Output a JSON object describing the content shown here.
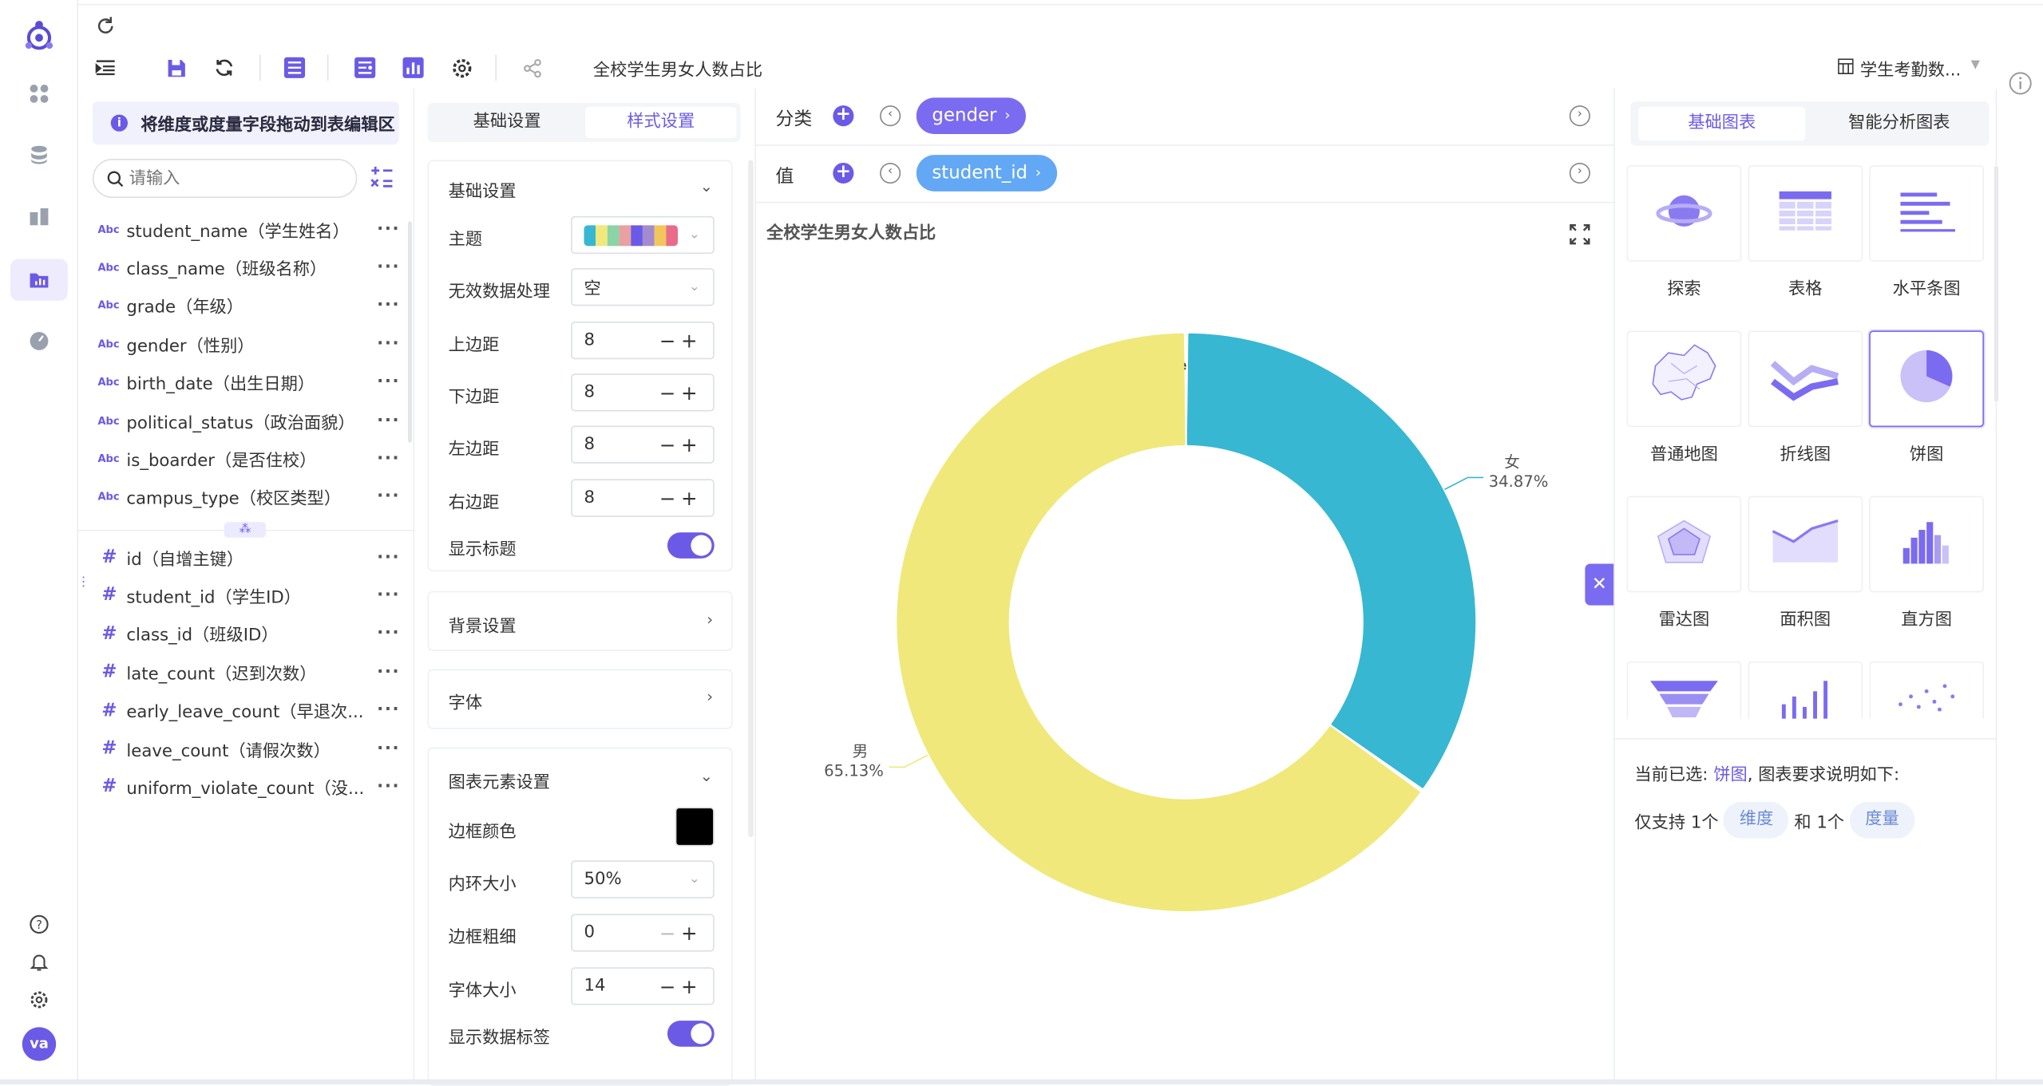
{
  "toolbar": {
    "chart_title": "全校学生男女人数占比",
    "dataset_name": "学生考勤数..."
  },
  "field_panel": {
    "hint": "将维度或度量字段拖动到表编辑区",
    "search_placeholder": "请输入",
    "dimension_type_label": "Abc",
    "measure_type_label": "#",
    "more": "···",
    "dimensions": [
      "student_name（学生姓名）",
      "class_name（班级名称）",
      "grade（年级）",
      "gender（性别）",
      "birth_date（出生日期）",
      "political_status（政治面貌）",
      "is_boarder（是否住校）",
      "campus_type（校区类型）"
    ],
    "measures": [
      "id（自增主键）",
      "student_id（学生ID）",
      "class_id（班级ID）",
      "late_count（迟到次数）",
      "early_leave_count（早退次...",
      "leave_count（请假次数）",
      "uniform_violate_count（没..."
    ]
  },
  "settings": {
    "tabs": [
      "基础设置",
      "样式设置"
    ],
    "active_tab": 1,
    "basic": {
      "title": "基础设置",
      "theme_label": "主题",
      "theme_colors": [
        "#37b7d2",
        "#f0e87a",
        "#8ad4a8",
        "#e8a0a0",
        "#6b5ae6",
        "#a38bd0",
        "#f3c65a",
        "#e86b8a"
      ],
      "invalid_label": "无效数据处理",
      "invalid_value": "空",
      "top_label": "上边距",
      "top_value": "8",
      "bottom_label": "下边距",
      "bottom_value": "8",
      "left_label": "左边距",
      "left_value": "8",
      "right_label": "右边距",
      "right_value": "8",
      "show_title_label": "显示标题",
      "show_title": true
    },
    "background_title": "背景设置",
    "font_title": "字体",
    "elements": {
      "title": "图表元素设置",
      "border_color_label": "边框颜色",
      "border_color": "#000000",
      "inner_ring_label": "内环大小",
      "inner_ring_value": "50%",
      "border_width_label": "边框粗细",
      "border_width_value": "0",
      "font_size_label": "字体大小",
      "font_size_value": "14",
      "show_labels_label": "显示数据标签",
      "show_labels": true
    }
  },
  "shelves": {
    "category_label": "分类",
    "category_field": "gender",
    "value_label": "值",
    "value_field": "student_id"
  },
  "chart_data": {
    "type": "pie",
    "title": "全校学生男女人数占比",
    "legend_title": "gender",
    "legend_position": "top-center",
    "inner_radius_ratio": 0.5,
    "categories": [
      "女",
      "男"
    ],
    "values": [
      34.87,
      65.13
    ],
    "labels": [
      "34.87%",
      "65.13%"
    ],
    "colors": [
      "#37b7d2",
      "#f0e87a"
    ]
  },
  "chart_types": {
    "tabs": [
      "基础图表",
      "智能分析图表"
    ],
    "active_tab": 0,
    "items": [
      "探索",
      "表格",
      "水平条图",
      "普通地图",
      "折线图",
      "饼图",
      "雷达图",
      "面积图",
      "直方图"
    ],
    "selected": "饼图"
  },
  "requirements": {
    "prefix": "当前已选:",
    "selected": "饼图",
    "suffix": ", 图表要求说明如下:",
    "only": "仅支持",
    "count1": "1个",
    "dimension": "维度",
    "and": "和",
    "count2": "1个",
    "measure": "度量"
  },
  "user": {
    "avatar": "va"
  },
  "colors": {
    "accent": "#6b5ae6",
    "pill_blue": "#62a8f5"
  }
}
